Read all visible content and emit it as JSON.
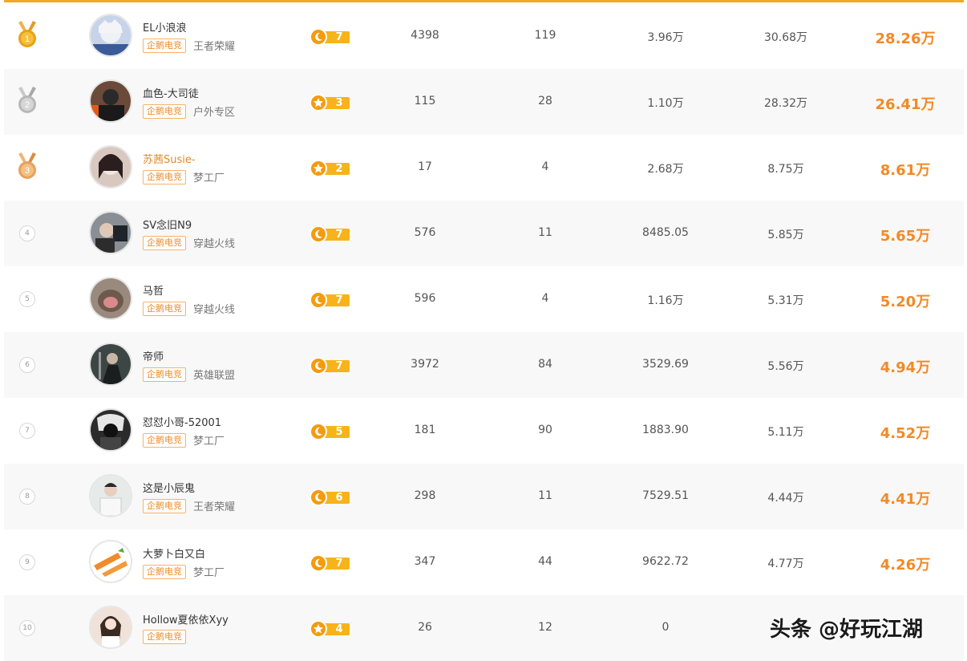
{
  "tag_label": "企鹅电竞",
  "colors": {
    "accent": "#f28a26",
    "tag_border": "#f6b26b",
    "level_pill": "#f7b31a",
    "gold": "#e7a21a",
    "silver": "#b8b8b8",
    "bronze": "#e6a25a"
  },
  "rows": [
    {
      "rank": "1",
      "medal": "gold",
      "avatar_icon": "avatar-anime",
      "avatar_color": "#c7d3e8",
      "name": "EL小浪浪",
      "game": "王者荣耀",
      "level": "7",
      "level_icon": "moon-icon",
      "c1": "4398",
      "c2": "119",
      "c3": "3.96万",
      "c4": "30.68万",
      "total": "28.26万"
    },
    {
      "rank": "2",
      "medal": "silver",
      "avatar_icon": "avatar-person",
      "avatar_color": "#6b4a3a",
      "name": "血色-大司徒",
      "game": "户外专区",
      "level": "3",
      "level_icon": "star-icon",
      "c1": "115",
      "c2": "28",
      "c3": "1.10万",
      "c4": "28.32万",
      "total": "26.41万"
    },
    {
      "rank": "3",
      "medal": "bronze",
      "avatar_icon": "avatar-person",
      "avatar_color": "#d9c8c0",
      "name": "苏茜Susie-",
      "game": "梦工厂",
      "level": "2",
      "level_icon": "star-icon",
      "c1": "17",
      "c2": "4",
      "c3": "2.68万",
      "c4": "8.75万",
      "total": "8.61万"
    },
    {
      "rank": "4",
      "medal": "",
      "avatar_icon": "avatar-person",
      "avatar_color": "#8a8e95",
      "name": "SV念旧N9",
      "game": "穿越火线",
      "level": "7",
      "level_icon": "moon-icon",
      "c1": "576",
      "c2": "11",
      "c3": "8485.05",
      "c4": "5.85万",
      "total": "5.65万"
    },
    {
      "rank": "5",
      "medal": "",
      "avatar_icon": "avatar-animal",
      "avatar_color": "#9a8a7e",
      "name": "马哲",
      "game": "穿越火线",
      "level": "7",
      "level_icon": "moon-icon",
      "c1": "596",
      "c2": "4",
      "c3": "1.16万",
      "c4": "5.31万",
      "total": "5.20万"
    },
    {
      "rank": "6",
      "medal": "",
      "avatar_icon": "avatar-person",
      "avatar_color": "#3c4644",
      "name": "帝师",
      "game": "英雄联盟",
      "level": "7",
      "level_icon": "moon-icon",
      "c1": "3972",
      "c2": "84",
      "c3": "3529.69",
      "c4": "5.56万",
      "total": "4.94万"
    },
    {
      "rank": "7",
      "medal": "",
      "avatar_icon": "avatar-person",
      "avatar_color": "#2b2b2b",
      "name": "怼怼小哥-52001",
      "game": "梦工厂",
      "level": "5",
      "level_icon": "moon-icon",
      "c1": "181",
      "c2": "90",
      "c3": "1883.90",
      "c4": "5.11万",
      "total": "4.52万"
    },
    {
      "rank": "8",
      "medal": "",
      "avatar_icon": "avatar-person",
      "avatar_color": "#e6ebea",
      "name": "这是小辰鬼",
      "game": "王者荣耀",
      "level": "6",
      "level_icon": "moon-icon",
      "c1": "298",
      "c2": "11",
      "c3": "7529.51",
      "c4": "4.44万",
      "total": "4.41万"
    },
    {
      "rank": "9",
      "medal": "",
      "avatar_icon": "avatar-carrot",
      "avatar_color": "#f08a2a",
      "name": "大萝卜白又白",
      "game": "梦工厂",
      "level": "7",
      "level_icon": "moon-icon",
      "c1": "347",
      "c2": "44",
      "c3": "9622.72",
      "c4": "4.77万",
      "total": "4.26万"
    },
    {
      "rank": "10",
      "medal": "",
      "avatar_icon": "avatar-person",
      "avatar_color": "#f0e2d8",
      "name": "Hollow夏依依Xyy",
      "game": "",
      "level": "4",
      "level_icon": "star-icon",
      "c1": "26",
      "c2": "12",
      "c3": "0",
      "c4": "",
      "total": ""
    }
  ],
  "watermark": "头条 @好玩江湖"
}
